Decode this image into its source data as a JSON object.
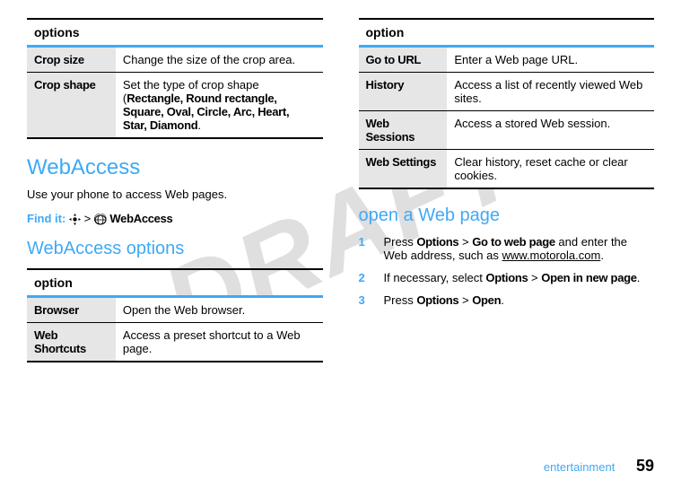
{
  "watermark": "DRAFT",
  "left": {
    "table1": {
      "header": "options",
      "rows": [
        {
          "label": "Crop size",
          "desc": "Change the size of the crop area."
        },
        {
          "label": "Crop shape",
          "desc_pre": "Set the type of crop shape (",
          "desc_bold": "Rectangle, Round rectangle, Square, Oval, Circle, Arc, Heart, Star, Diamond",
          "desc_post": "."
        }
      ]
    },
    "h2": "WebAccess",
    "intro": "Use your phone to access Web pages.",
    "findit_label": "Find it:",
    "findit_gt": ">",
    "findit_app": "WebAccess",
    "h3": "WebAccess options",
    "table2": {
      "header": "option",
      "rows": [
        {
          "label": "Browser",
          "desc": "Open the Web browser."
        },
        {
          "label": "Web Shortcuts",
          "desc": "Access a preset shortcut to a Web page."
        }
      ]
    }
  },
  "right": {
    "table1": {
      "header": "option",
      "rows": [
        {
          "label": "Go to URL",
          "desc": "Enter a Web page URL."
        },
        {
          "label": "History",
          "desc": "Access a list of recently viewed Web sites."
        },
        {
          "label": "Web Sessions",
          "desc": "Access a stored Web session."
        },
        {
          "label": "Web Settings",
          "desc": "Clear history, reset cache or clear cookies."
        }
      ]
    },
    "h3": "open a Web page",
    "steps": [
      {
        "n": "1",
        "pre": "Press ",
        "b1": "Options",
        "mid1": " > ",
        "b2": "Go to web page",
        "mid2": " and enter the Web address, such as ",
        "u": "www.motorola.com",
        "post": "."
      },
      {
        "n": "2",
        "pre": "If necessary, select ",
        "b1": "Options",
        "mid1": " > ",
        "b2": "Open in new page",
        "post": "."
      },
      {
        "n": "3",
        "pre": "Press ",
        "b1": "Options",
        "mid1": " > ",
        "b2": "Open",
        "post": "."
      }
    ]
  },
  "footer": {
    "section": "entertainment",
    "page": "59"
  }
}
